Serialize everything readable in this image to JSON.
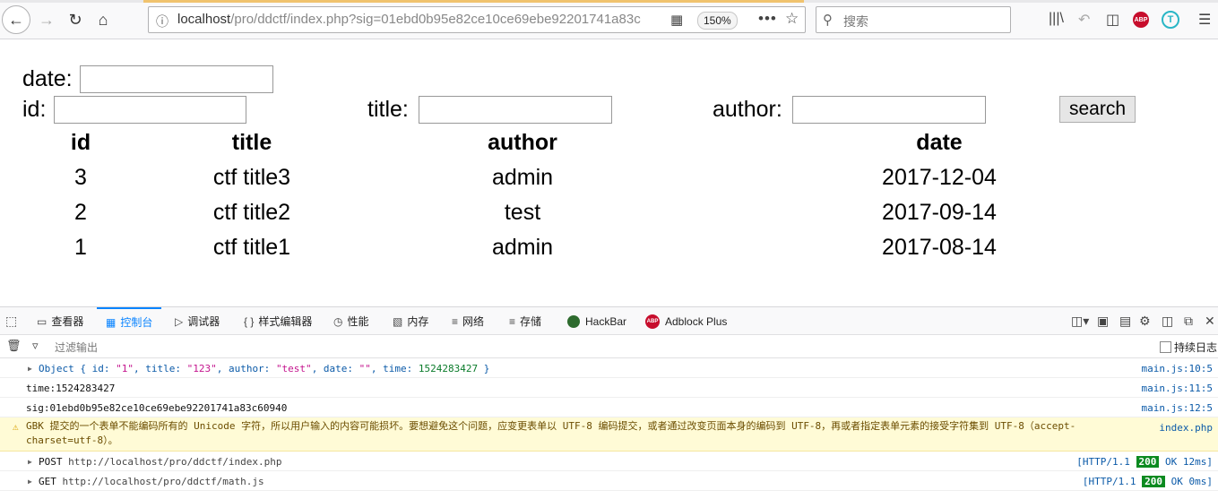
{
  "browser": {
    "url_main": "localhost",
    "url_rest": "/pro/ddctf/index.php?sig=01ebd0b95e82ce10ce69ebe92201741a83c",
    "zoom": "150%",
    "search_placeholder": "搜索",
    "abp_label": "ABP",
    "t_label": "T"
  },
  "form": {
    "date_label": "date:",
    "id_label": "id:",
    "title_label": "title:",
    "author_label": "author:",
    "search_label": "search"
  },
  "table": {
    "headers": [
      "id",
      "title",
      "author",
      "date"
    ],
    "rows": [
      [
        "3",
        "ctf title3",
        "admin",
        "2017-12-04"
      ],
      [
        "2",
        "ctf title2",
        "test",
        "2017-09-14"
      ],
      [
        "1",
        "ctf title1",
        "admin",
        "2017-08-14"
      ]
    ]
  },
  "devtools": {
    "tabs": [
      "查看器",
      "控制台",
      "调试器",
      "样式编辑器",
      "性能",
      "内存",
      "网络",
      "存储",
      "HackBar",
      "Adblock Plus"
    ],
    "filter_placeholder": "过滤输出",
    "persist_label": "持续日志",
    "log": {
      "object_line": {
        "prefix": "Object { id: ",
        "id": "\"1\"",
        "k_title": ", title: ",
        "title": "\"123\"",
        "k_author": ", author: ",
        "author": "\"test\"",
        "k_date": ", date: ",
        "date": "\"\"",
        "k_time": ", time: ",
        "time": "1524283427",
        "suffix": " }",
        "source": "main.js:10:5"
      },
      "time_line": {
        "text": "time:1524283427",
        "source": "main.js:11:5"
      },
      "sig_line": {
        "text": "sig:01ebd0b95e82ce10ce69ebe92201741a83c60940",
        "source": "main.js:12:5"
      },
      "warning": {
        "text": "GBK 提交的一个表单不能编码所有的 Unicode 字符，所以用户输入的内容可能损坏。要想避免这个问题，应变更表单以 UTF-8 编码提交，或者通过改变页面本身的编码到 UTF-8，再或者指定表单元素的接受字符集到 UTF-8（accept-charset=utf-8）。",
        "source": "index.php"
      },
      "requests": [
        {
          "method": "POST",
          "url": "http://localhost/pro/ddctf/index.php",
          "proto": "[HTTP/1.1",
          "status": "200",
          "tail": "OK 12ms]"
        },
        {
          "method": "GET",
          "url": "http://localhost/pro/ddctf/math.js",
          "proto": "[HTTP/1.1",
          "status": "200",
          "tail": "OK 0ms]"
        }
      ]
    }
  }
}
